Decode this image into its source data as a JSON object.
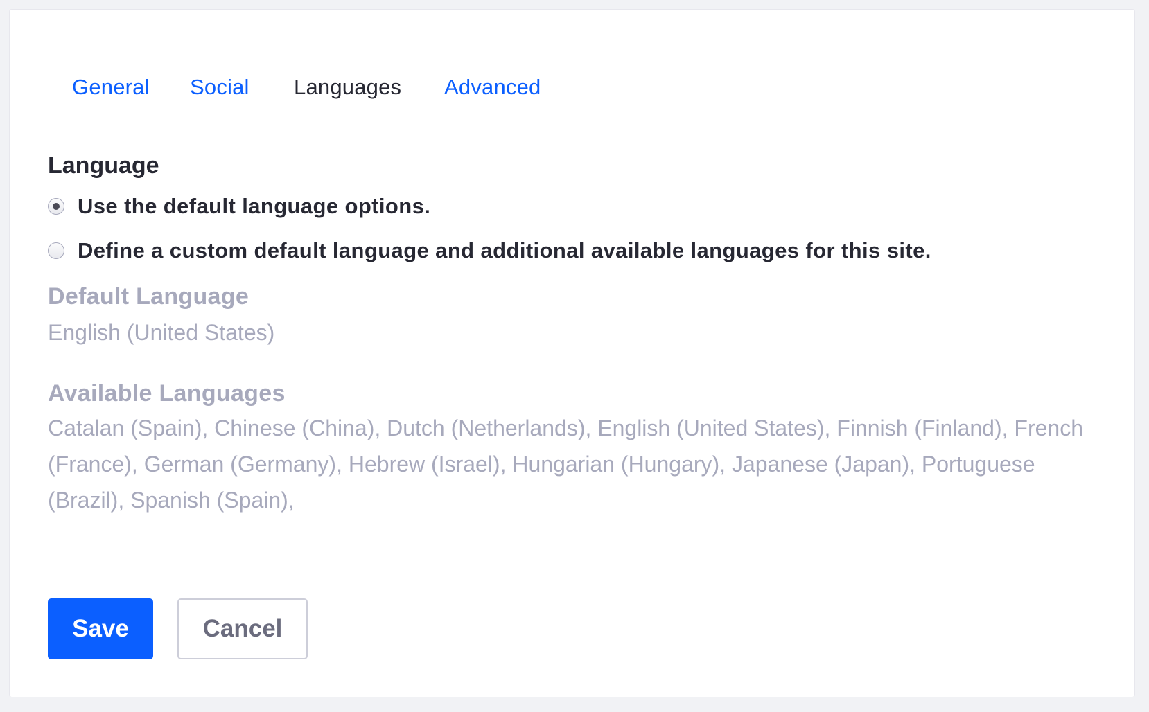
{
  "tabs": [
    {
      "label": "General",
      "active": false
    },
    {
      "label": "Social",
      "active": false
    },
    {
      "label": "Languages",
      "active": true
    },
    {
      "label": "Advanced",
      "active": false
    }
  ],
  "language_section": {
    "title": "Language",
    "options": [
      {
        "label": "Use the default language options.",
        "checked": true
      },
      {
        "label": "Define a custom default language and additional available languages for this site.",
        "checked": false
      }
    ]
  },
  "default_language": {
    "heading": "Default Language",
    "value": "English (United States)"
  },
  "available_languages": {
    "heading": "Available Languages",
    "value": "Catalan (Spain), Chinese (China), Dutch (Netherlands), English (United States), Finnish (Finland), French (France), German (Germany), Hebrew (Israel), Hungarian (Hungary), Japanese (Japan), Portuguese (Brazil), Spanish (Spain),"
  },
  "actions": {
    "save_label": "Save",
    "cancel_label": "Cancel"
  },
  "colors": {
    "primary": "#0b5fff",
    "text": "#272833",
    "muted": "#a7a9bc",
    "page_background": "#f1f2f5"
  }
}
